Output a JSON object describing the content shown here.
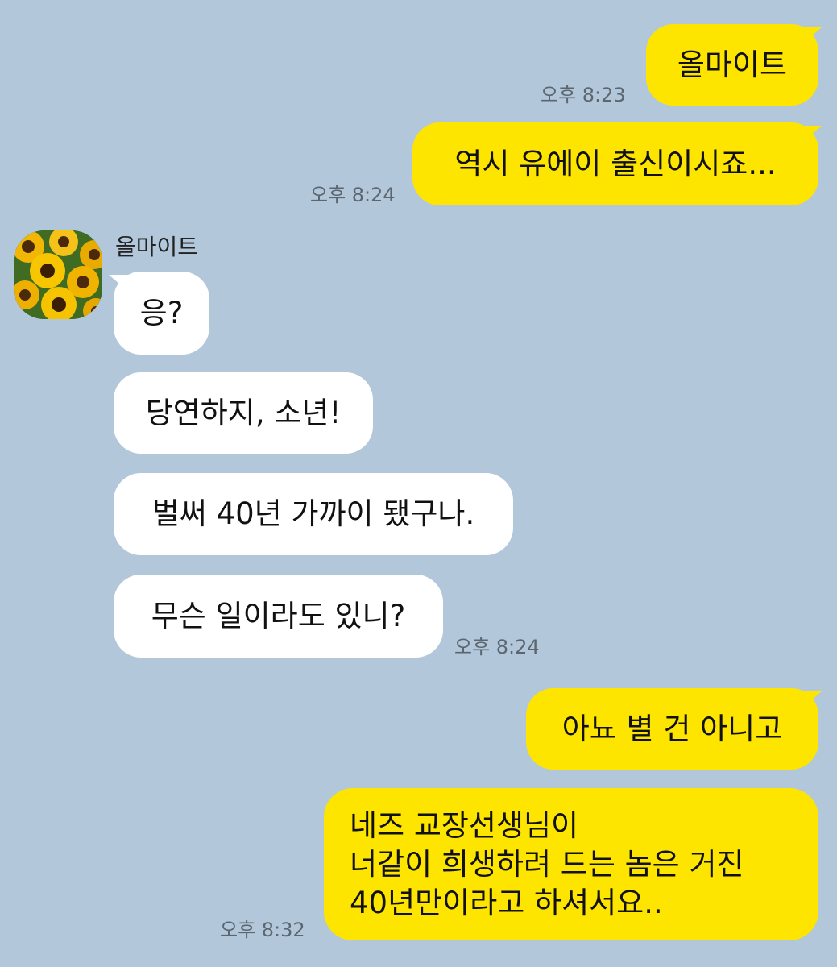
{
  "conversation": {
    "contact_name": "올마이트",
    "messages": [
      {
        "text": "올마이트",
        "time": "오후 8:23"
      },
      {
        "text": "역시 유에이 출신이시죠...",
        "time": "오후 8:24"
      },
      {
        "text": "응?"
      },
      {
        "text": "당연하지, 소년!"
      },
      {
        "text": "벌써 40년 가까이 됐구나."
      },
      {
        "text": "무슨 일이라도 있니?",
        "time": "오후 8:24"
      },
      {
        "text": "아뇨 별 건 아니고"
      },
      {
        "text": "네즈 교장선생님이\n너같이 희생하려 드는 놈은 거진\n40년만이라고 하셔서요..",
        "time": "오후 8:32"
      }
    ]
  },
  "colors": {
    "background": "#b2c7da",
    "sent_bubble": "#fee500",
    "received_bubble": "#ffffff"
  },
  "icons": {
    "avatar": "sunflower-avatar-icon"
  }
}
